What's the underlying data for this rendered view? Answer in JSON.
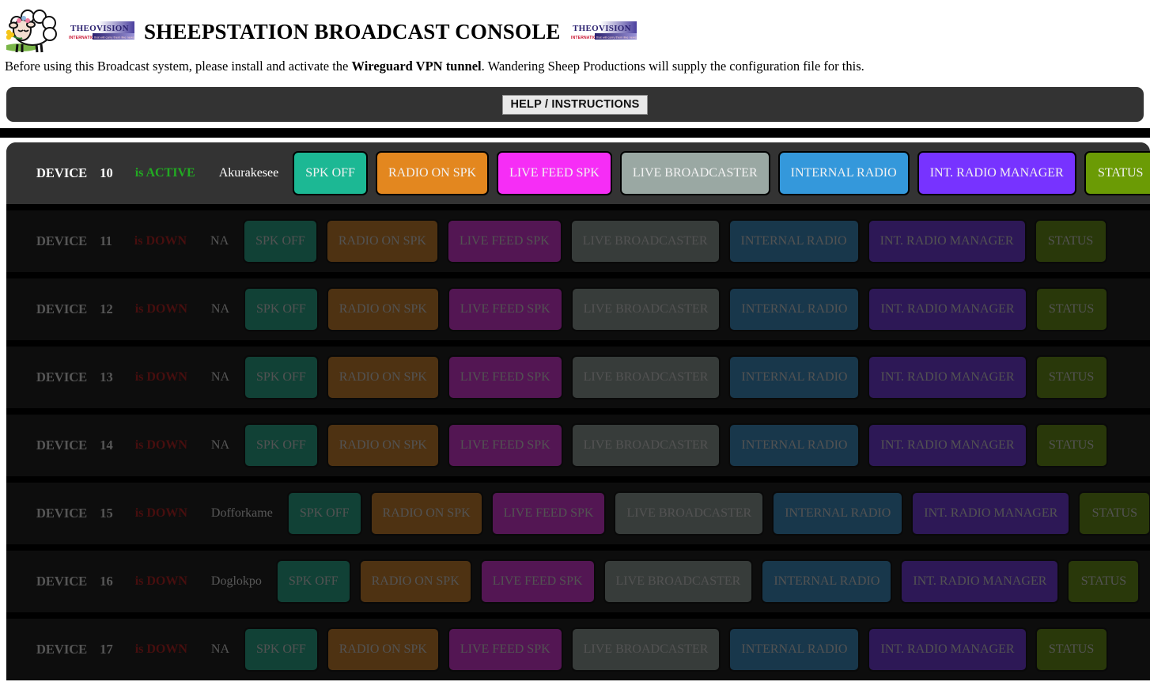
{
  "header": {
    "title": "SHEEPSTATION BROADCAST CONSOLE",
    "brand_logo_text": "THEOVISION",
    "brand_logo_sub": "INTERNATIONAL",
    "sheep_icon": "sheep-logo-icon"
  },
  "intro": {
    "part1": "Before using this Broadcast system, please install and activate the ",
    "emphasis": "Wireguard VPN tunnel",
    "part2": ". Wandering Sheep Productions will supply the configuration file for this."
  },
  "help_bar": {
    "button_label": "HELP / INSTRUCTIONS"
  },
  "colors": {
    "spk_off": "#1cb894",
    "radio_on_spk": "#e3871f",
    "live_feed_spk": "#f62df6",
    "live_broadcaster": "#9aa8a3",
    "internal_radio": "#3498db",
    "int_radio_manager": "#7733ff",
    "status": "#6b9b05",
    "active_text": "#22aa22",
    "down_text": "#cc1111",
    "row_active_bg": "#333333",
    "row_down_bg": "#0d0d0d"
  },
  "button_labels": {
    "spk": "SPK OFF",
    "radio": "RADIO ON SPK",
    "feed": "LIVE FEED SPK",
    "live": "LIVE BROADCASTER",
    "internal": "INTERNAL RADIO",
    "manager": "INT. RADIO MANAGER",
    "status": "STATUS"
  },
  "device_word": "DEVICE",
  "devices": [
    {
      "number": "10",
      "state": "is ACTIVE",
      "status": "active",
      "name": "Akurakesee"
    },
    {
      "number": "11",
      "state": "is DOWN",
      "status": "down",
      "name": "NA"
    },
    {
      "number": "12",
      "state": "is DOWN",
      "status": "down",
      "name": "NA"
    },
    {
      "number": "13",
      "state": "is DOWN",
      "status": "down",
      "name": "NA"
    },
    {
      "number": "14",
      "state": "is DOWN",
      "status": "down",
      "name": "NA"
    },
    {
      "number": "15",
      "state": "is DOWN",
      "status": "down",
      "name": "Dofforkame"
    },
    {
      "number": "16",
      "state": "is DOWN",
      "status": "down",
      "name": "Doglokpo"
    },
    {
      "number": "17",
      "state": "is DOWN",
      "status": "down",
      "name": "NA"
    }
  ]
}
